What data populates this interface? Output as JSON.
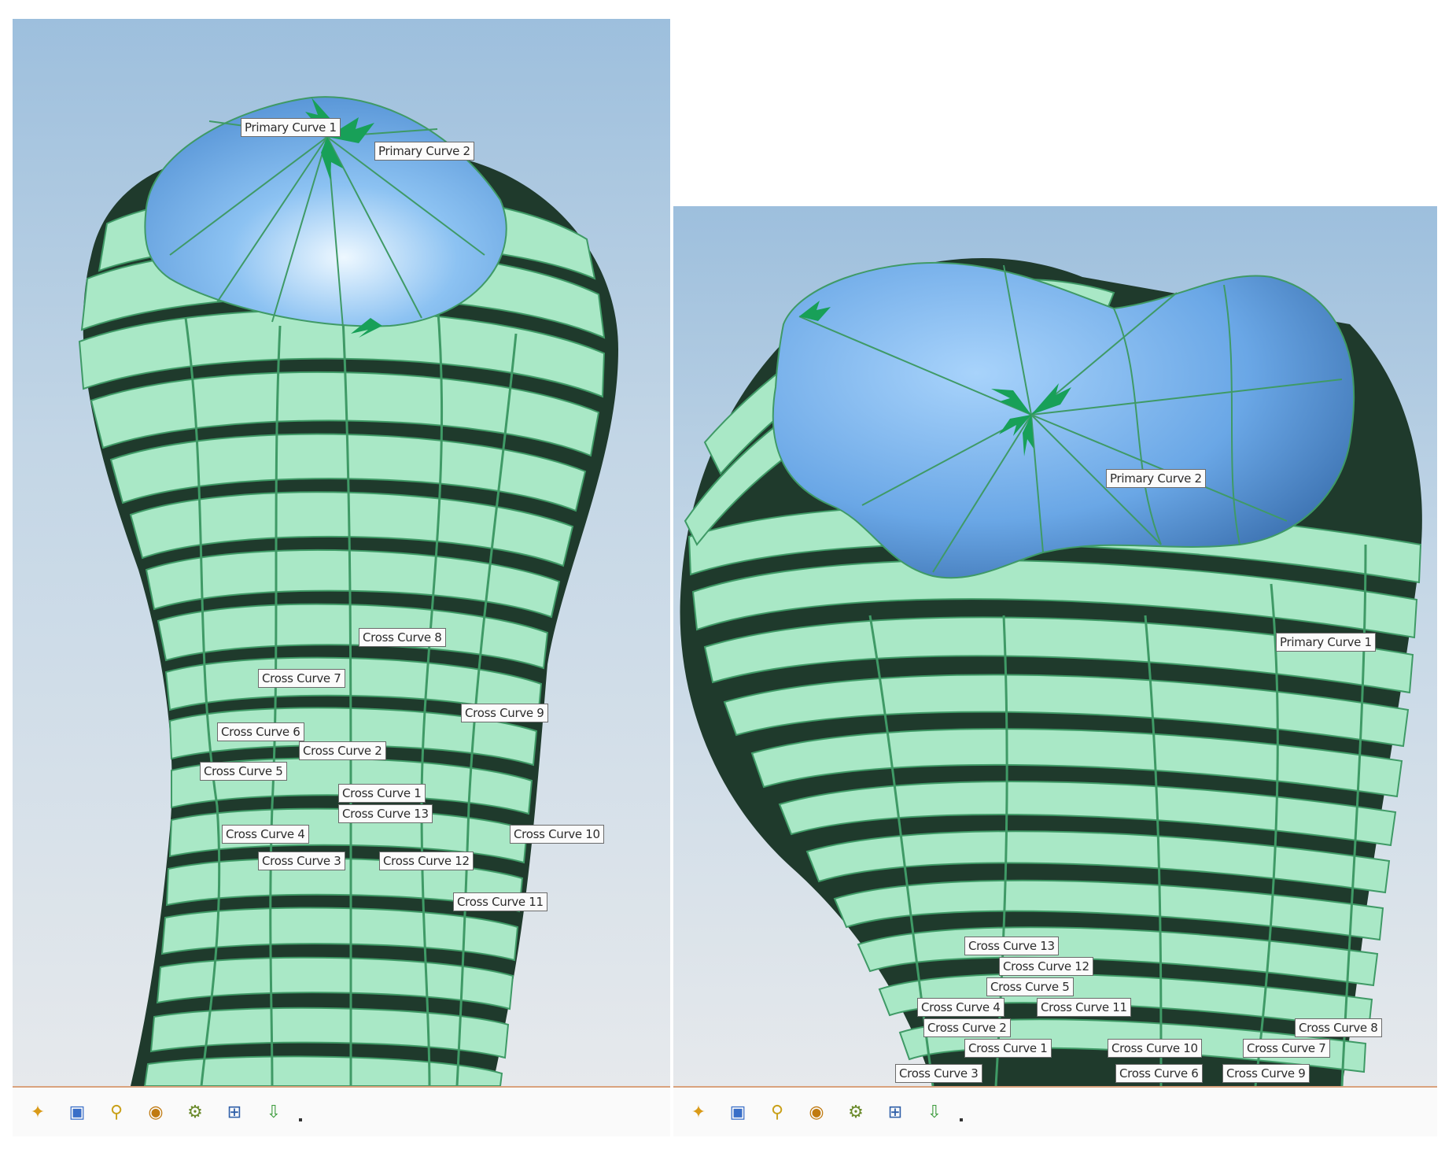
{
  "left_view": {
    "primary_labels": [
      "Primary Curve 1",
      "Primary Curve 2"
    ],
    "cross_labels": [
      "Cross Curve 8",
      "Cross Curve 7",
      "Cross Curve 9",
      "Cross Curve 6",
      "Cross Curve 2",
      "Cross Curve 5",
      "Cross Curve 1",
      "Cross Curve 13",
      "Cross Curve 4",
      "Cross Curve 10",
      "Cross Curve 3",
      "Cross Curve 12",
      "Cross Curve 11"
    ]
  },
  "right_view": {
    "primary_labels": [
      "Primary Curve 2",
      "Primary Curve 1"
    ],
    "cross_labels": [
      "Cross Curve 13",
      "Cross Curve 12",
      "Cross Curve 5",
      "Cross Curve 4",
      "Cross Curve 11",
      "Cross Curve 2",
      "Cross Curve 8",
      "Cross Curve 1",
      "Cross Curve 10",
      "Cross Curve 7",
      "Cross Curve 3",
      "Cross Curve 6",
      "Cross Curve 9"
    ]
  },
  "toolbar": {
    "icons": [
      "new-sketch-icon",
      "display-icon",
      "link-icon",
      "play-icon",
      "node-tool-icon",
      "grid-tool-icon",
      "sort-down-icon"
    ]
  },
  "colors": {
    "mesh_fill": "#a9e8c6",
    "mesh_line": "#3f9a66",
    "gap_dark": "#1f3a2c",
    "cap_fill": "#78b4ee",
    "arrow": "#18a058",
    "bg_top": "#9dbfdd",
    "bg_bottom": "#e6e9ec"
  }
}
